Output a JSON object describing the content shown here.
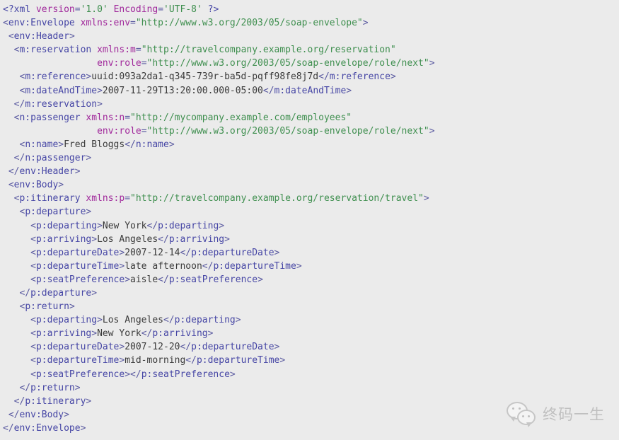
{
  "document": {
    "type": "soap-xml-envelope",
    "language": "xml",
    "background_color": "#ebebeb",
    "colors": {
      "tag": "#4646a5",
      "attribute_name": "#a0289b",
      "attribute_value": "#3f8f4f",
      "text_content": "#3b3b3b",
      "punctuation": "#5a5aa0"
    },
    "declaration": {
      "open": "<?xml",
      "version_attr": "version",
      "version_value": "'1.0'",
      "encoding_attr": "Encoding",
      "encoding_value": "'UTF-8'",
      "close": "?>"
    },
    "namespaces": {
      "env": "http://www.w3.org/2003/05/soap-envelope",
      "m": "http://travelcompany.example.org/reservation",
      "n": "http://mycompany.example.com/employees",
      "p": "http://travelcompany.example.org/reservation/travel",
      "role_next": "http://www.w3.org/2003/05/soap-envelope/role/next"
    },
    "values": {
      "reference": "uuid:093a2da1-q345-739r-ba5d-pqff98fe8j7d",
      "dateAndTime": "2007-11-29T13:20:00.000-05:00",
      "passenger_name": "Fred Bloggs",
      "departure": {
        "departing": "New York",
        "arriving": "Los Angeles",
        "departureDate": "2007-12-14",
        "departureTime": "late afternoon",
        "seatPreference": "aisle"
      },
      "return": {
        "departing": "Los Angeles",
        "arriving": "New York",
        "departureDate": "2007-12-20",
        "departureTime": "mid-morning",
        "seatPreference": ""
      }
    },
    "lines": [
      {
        "indent": 0,
        "tokens": [
          {
            "t": "decl",
            "v": "<?xml"
          },
          {
            "t": "plain",
            "v": " "
          },
          {
            "t": "declattr",
            "v": "version"
          },
          {
            "t": "punct",
            "v": "="
          },
          {
            "t": "str",
            "v": "'1.0'"
          },
          {
            "t": "plain",
            "v": " "
          },
          {
            "t": "declattr",
            "v": "Encoding"
          },
          {
            "t": "punct",
            "v": "="
          },
          {
            "t": "str",
            "v": "'UTF-8'"
          },
          {
            "t": "plain",
            "v": " "
          },
          {
            "t": "decl",
            "v": "?>"
          }
        ]
      },
      {
        "indent": 0,
        "tokens": [
          {
            "t": "punct",
            "v": "<"
          },
          {
            "t": "tag",
            "v": "env:Envelope"
          },
          {
            "t": "plain",
            "v": " "
          },
          {
            "t": "attr",
            "v": "xmlns:env"
          },
          {
            "t": "punct",
            "v": "="
          },
          {
            "t": "str",
            "v": "\"http://www.w3.org/2003/05/soap-envelope\""
          },
          {
            "t": "punct",
            "v": ">"
          }
        ]
      },
      {
        "indent": 1,
        "tokens": [
          {
            "t": "punct",
            "v": "<"
          },
          {
            "t": "tag",
            "v": "env:Header"
          },
          {
            "t": "punct",
            "v": ">"
          }
        ]
      },
      {
        "indent": 2,
        "tokens": [
          {
            "t": "punct",
            "v": "<"
          },
          {
            "t": "tag",
            "v": "m:reservation"
          },
          {
            "t": "plain",
            "v": " "
          },
          {
            "t": "attr",
            "v": "xmlns:m"
          },
          {
            "t": "punct",
            "v": "="
          },
          {
            "t": "str",
            "v": "\"http://travelcompany.example.org/reservation\""
          }
        ]
      },
      {
        "indent": 0,
        "pad": 17,
        "tokens": [
          {
            "t": "attr",
            "v": "env:role"
          },
          {
            "t": "punct",
            "v": "="
          },
          {
            "t": "str",
            "v": "\"http://www.w3.org/2003/05/soap-envelope/role/next\""
          },
          {
            "t": "punct",
            "v": ">"
          }
        ]
      },
      {
        "indent": 3,
        "tokens": [
          {
            "t": "punct",
            "v": "<"
          },
          {
            "t": "tag",
            "v": "m:reference"
          },
          {
            "t": "punct",
            "v": ">"
          },
          {
            "t": "txt",
            "v": "uuid:093a2da1-q345-739r-ba5d-pqff98fe8j7d"
          },
          {
            "t": "punct",
            "v": "</"
          },
          {
            "t": "tag",
            "v": "m:reference"
          },
          {
            "t": "punct",
            "v": ">"
          }
        ]
      },
      {
        "indent": 3,
        "tokens": [
          {
            "t": "punct",
            "v": "<"
          },
          {
            "t": "tag",
            "v": "m:dateAndTime"
          },
          {
            "t": "punct",
            "v": ">"
          },
          {
            "t": "txt",
            "v": "2007-11-29T13:20:00.000-05:00"
          },
          {
            "t": "punct",
            "v": "</"
          },
          {
            "t": "tag",
            "v": "m:dateAndTime"
          },
          {
            "t": "punct",
            "v": ">"
          }
        ]
      },
      {
        "indent": 2,
        "tokens": [
          {
            "t": "punct",
            "v": "</"
          },
          {
            "t": "tag",
            "v": "m:reservation"
          },
          {
            "t": "punct",
            "v": ">"
          }
        ]
      },
      {
        "indent": 2,
        "tokens": [
          {
            "t": "punct",
            "v": "<"
          },
          {
            "t": "tag",
            "v": "n:passenger"
          },
          {
            "t": "plain",
            "v": " "
          },
          {
            "t": "attr",
            "v": "xmlns:n"
          },
          {
            "t": "punct",
            "v": "="
          },
          {
            "t": "str",
            "v": "\"http://mycompany.example.com/employees\""
          }
        ]
      },
      {
        "indent": 0,
        "pad": 17,
        "tokens": [
          {
            "t": "attr",
            "v": "env:role"
          },
          {
            "t": "punct",
            "v": "="
          },
          {
            "t": "str",
            "v": "\"http://www.w3.org/2003/05/soap-envelope/role/next\""
          },
          {
            "t": "punct",
            "v": ">"
          }
        ]
      },
      {
        "indent": 3,
        "tokens": [
          {
            "t": "punct",
            "v": "<"
          },
          {
            "t": "tag",
            "v": "n:name"
          },
          {
            "t": "punct",
            "v": ">"
          },
          {
            "t": "txt",
            "v": "Fred Bloggs"
          },
          {
            "t": "punct",
            "v": "</"
          },
          {
            "t": "tag",
            "v": "n:name"
          },
          {
            "t": "punct",
            "v": ">"
          }
        ]
      },
      {
        "indent": 2,
        "tokens": [
          {
            "t": "punct",
            "v": "</"
          },
          {
            "t": "tag",
            "v": "n:passenger"
          },
          {
            "t": "punct",
            "v": ">"
          }
        ]
      },
      {
        "indent": 1,
        "tokens": [
          {
            "t": "punct",
            "v": "</"
          },
          {
            "t": "tag",
            "v": "env:Header"
          },
          {
            "t": "punct",
            "v": ">"
          }
        ]
      },
      {
        "indent": 1,
        "tokens": [
          {
            "t": "punct",
            "v": "<"
          },
          {
            "t": "tag",
            "v": "env:Body"
          },
          {
            "t": "punct",
            "v": ">"
          }
        ]
      },
      {
        "indent": 2,
        "tokens": [
          {
            "t": "punct",
            "v": "<"
          },
          {
            "t": "tag",
            "v": "p:itinerary"
          },
          {
            "t": "plain",
            "v": " "
          },
          {
            "t": "attr",
            "v": "xmlns:p"
          },
          {
            "t": "punct",
            "v": "="
          },
          {
            "t": "str",
            "v": "\"http://travelcompany.example.org/reservation/travel\""
          },
          {
            "t": "punct",
            "v": ">"
          }
        ]
      },
      {
        "indent": 3,
        "tokens": [
          {
            "t": "punct",
            "v": "<"
          },
          {
            "t": "tag",
            "v": "p:departure"
          },
          {
            "t": "punct",
            "v": ">"
          }
        ]
      },
      {
        "indent": 5,
        "tokens": [
          {
            "t": "punct",
            "v": "<"
          },
          {
            "t": "tag",
            "v": "p:departing"
          },
          {
            "t": "punct",
            "v": ">"
          },
          {
            "t": "txt",
            "v": "New York"
          },
          {
            "t": "punct",
            "v": "</"
          },
          {
            "t": "tag",
            "v": "p:departing"
          },
          {
            "t": "punct",
            "v": ">"
          }
        ]
      },
      {
        "indent": 5,
        "tokens": [
          {
            "t": "punct",
            "v": "<"
          },
          {
            "t": "tag",
            "v": "p:arriving"
          },
          {
            "t": "punct",
            "v": ">"
          },
          {
            "t": "txt",
            "v": "Los Angeles"
          },
          {
            "t": "punct",
            "v": "</"
          },
          {
            "t": "tag",
            "v": "p:arriving"
          },
          {
            "t": "punct",
            "v": ">"
          }
        ]
      },
      {
        "indent": 5,
        "tokens": [
          {
            "t": "punct",
            "v": "<"
          },
          {
            "t": "tag",
            "v": "p:departureDate"
          },
          {
            "t": "punct",
            "v": ">"
          },
          {
            "t": "txt",
            "v": "2007-12-14"
          },
          {
            "t": "punct",
            "v": "</"
          },
          {
            "t": "tag",
            "v": "p:departureDate"
          },
          {
            "t": "punct",
            "v": ">"
          }
        ]
      },
      {
        "indent": 5,
        "tokens": [
          {
            "t": "punct",
            "v": "<"
          },
          {
            "t": "tag",
            "v": "p:departureTime"
          },
          {
            "t": "punct",
            "v": ">"
          },
          {
            "t": "txt",
            "v": "late afternoon"
          },
          {
            "t": "punct",
            "v": "</"
          },
          {
            "t": "tag",
            "v": "p:departureTime"
          },
          {
            "t": "punct",
            "v": ">"
          }
        ]
      },
      {
        "indent": 5,
        "tokens": [
          {
            "t": "punct",
            "v": "<"
          },
          {
            "t": "tag",
            "v": "p:seatPreference"
          },
          {
            "t": "punct",
            "v": ">"
          },
          {
            "t": "txt",
            "v": "aisle"
          },
          {
            "t": "punct",
            "v": "</"
          },
          {
            "t": "tag",
            "v": "p:seatPreference"
          },
          {
            "t": "punct",
            "v": ">"
          }
        ]
      },
      {
        "indent": 3,
        "tokens": [
          {
            "t": "punct",
            "v": "</"
          },
          {
            "t": "tag",
            "v": "p:departure"
          },
          {
            "t": "punct",
            "v": ">"
          }
        ]
      },
      {
        "indent": 3,
        "tokens": [
          {
            "t": "punct",
            "v": "<"
          },
          {
            "t": "tag",
            "v": "p:return"
          },
          {
            "t": "punct",
            "v": ">"
          }
        ]
      },
      {
        "indent": 5,
        "tokens": [
          {
            "t": "punct",
            "v": "<"
          },
          {
            "t": "tag",
            "v": "p:departing"
          },
          {
            "t": "punct",
            "v": ">"
          },
          {
            "t": "txt",
            "v": "Los Angeles"
          },
          {
            "t": "punct",
            "v": "</"
          },
          {
            "t": "tag",
            "v": "p:departing"
          },
          {
            "t": "punct",
            "v": ">"
          }
        ]
      },
      {
        "indent": 5,
        "tokens": [
          {
            "t": "punct",
            "v": "<"
          },
          {
            "t": "tag",
            "v": "p:arriving"
          },
          {
            "t": "punct",
            "v": ">"
          },
          {
            "t": "txt",
            "v": "New York"
          },
          {
            "t": "punct",
            "v": "</"
          },
          {
            "t": "tag",
            "v": "p:arriving"
          },
          {
            "t": "punct",
            "v": ">"
          }
        ]
      },
      {
        "indent": 5,
        "tokens": [
          {
            "t": "punct",
            "v": "<"
          },
          {
            "t": "tag",
            "v": "p:departureDate"
          },
          {
            "t": "punct",
            "v": ">"
          },
          {
            "t": "txt",
            "v": "2007-12-20"
          },
          {
            "t": "punct",
            "v": "</"
          },
          {
            "t": "tag",
            "v": "p:departureDate"
          },
          {
            "t": "punct",
            "v": ">"
          }
        ]
      },
      {
        "indent": 5,
        "tokens": [
          {
            "t": "punct",
            "v": "<"
          },
          {
            "t": "tag",
            "v": "p:departureTime"
          },
          {
            "t": "punct",
            "v": ">"
          },
          {
            "t": "txt",
            "v": "mid-morning"
          },
          {
            "t": "punct",
            "v": "</"
          },
          {
            "t": "tag",
            "v": "p:departureTime"
          },
          {
            "t": "punct",
            "v": ">"
          }
        ]
      },
      {
        "indent": 5,
        "tokens": [
          {
            "t": "punct",
            "v": "<"
          },
          {
            "t": "tag",
            "v": "p:seatPreference"
          },
          {
            "t": "punct",
            "v": ">"
          },
          {
            "t": "punct",
            "v": "</"
          },
          {
            "t": "tag",
            "v": "p:seatPreference"
          },
          {
            "t": "punct",
            "v": ">"
          }
        ]
      },
      {
        "indent": 3,
        "tokens": [
          {
            "t": "punct",
            "v": "</"
          },
          {
            "t": "tag",
            "v": "p:return"
          },
          {
            "t": "punct",
            "v": ">"
          }
        ]
      },
      {
        "indent": 2,
        "tokens": [
          {
            "t": "punct",
            "v": "</"
          },
          {
            "t": "tag",
            "v": "p:itinerary"
          },
          {
            "t": "punct",
            "v": ">"
          }
        ]
      },
      {
        "indent": 1,
        "tokens": [
          {
            "t": "punct",
            "v": "</"
          },
          {
            "t": "tag",
            "v": "env:Body"
          },
          {
            "t": "punct",
            "v": ">"
          }
        ]
      },
      {
        "indent": 0,
        "tokens": [
          {
            "t": "punct",
            "v": "</"
          },
          {
            "t": "tag",
            "v": "env:Envelope"
          },
          {
            "t": "punct",
            "v": ">"
          }
        ]
      }
    ]
  },
  "watermark": {
    "text": "终码一生",
    "logo": "wechat-icon"
  }
}
